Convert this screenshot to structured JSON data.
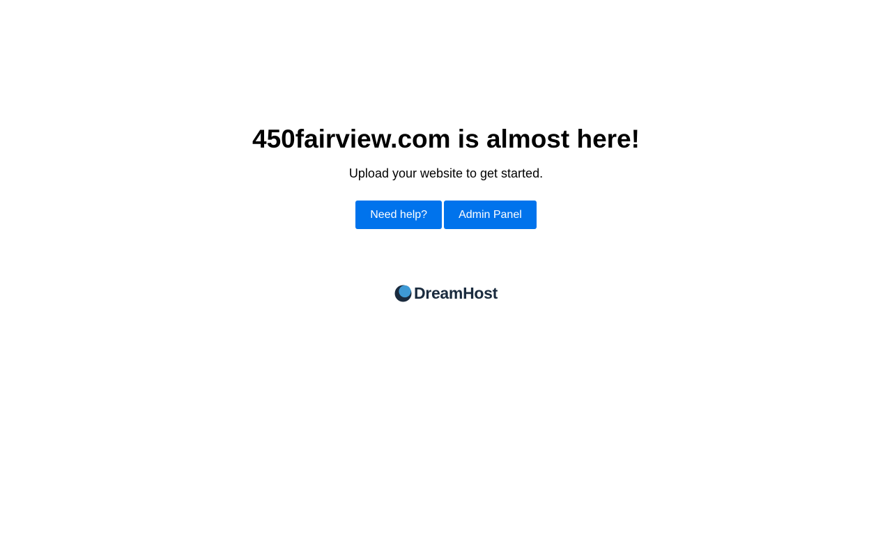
{
  "main": {
    "headline": "450fairview.com is almost here!",
    "subline": "Upload your website to get started.",
    "buttons": [
      {
        "label": "Need help?"
      },
      {
        "label": "Admin Panel"
      }
    ]
  },
  "brand": {
    "name": "DreamHost",
    "icon": "dreamhost-moon-icon"
  },
  "colors": {
    "button_bg": "#0073ec",
    "button_text": "#ffffff",
    "logo_text": "#1a2b3e",
    "logo_moon_light": "#3e99d4",
    "logo_moon_dark": "#1a2b3e"
  }
}
